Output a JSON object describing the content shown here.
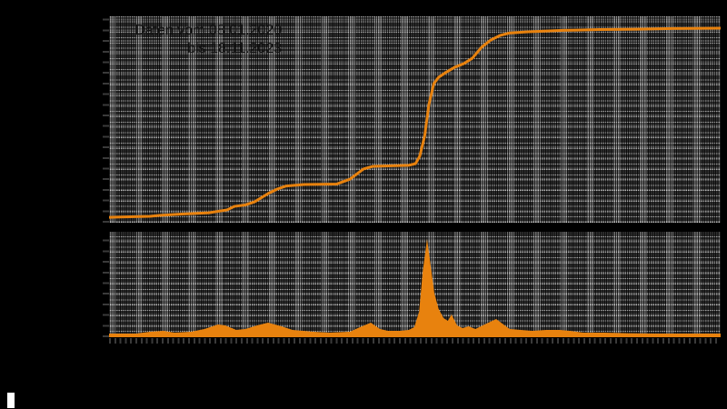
{
  "title": {
    "line1": "Daten vom 08.01.2020",
    "line2": "bis 18.11.2023"
  },
  "colors": {
    "page_background": "#000000",
    "plot_background": "#333333",
    "plot_band_light": "#6E6E6E",
    "grid_line": "#FFFFFF",
    "series_orange": "#E8820E",
    "title_text": "#121212",
    "cursor": "#FFFFFF"
  },
  "chart_data": [
    {
      "type": "line",
      "name": "cumulative-total",
      "title": "Daten vom 08.01.2020 bis 18.11.2023",
      "x_range": [
        "08.01.2020",
        "18.11.2023"
      ],
      "ylim": [
        0,
        100
      ],
      "y_unit": "percent-of-panel-height (no visible axis labels)",
      "grid": true,
      "legend": "none",
      "series": [
        {
          "name": "cumulative",
          "color": "#E8820E",
          "points": [
            [
              0.0,
              2.6
            ],
            [
              0.067,
              3.1
            ],
            [
              0.082,
              3.5
            ],
            [
              0.119,
              4.2
            ],
            [
              0.163,
              4.8
            ],
            [
              0.193,
              6.2
            ],
            [
              0.205,
              7.9
            ],
            [
              0.223,
              8.6
            ],
            [
              0.238,
              10.1
            ],
            [
              0.26,
              14.1
            ],
            [
              0.275,
              16.3
            ],
            [
              0.29,
              17.8
            ],
            [
              0.319,
              18.5
            ],
            [
              0.372,
              18.7
            ],
            [
              0.394,
              21.1
            ],
            [
              0.416,
              26.0
            ],
            [
              0.431,
              27.3
            ],
            [
              0.49,
              27.8
            ],
            [
              0.501,
              28.6
            ],
            [
              0.508,
              32.2
            ],
            [
              0.516,
              41.9
            ],
            [
              0.523,
              57.3
            ],
            [
              0.531,
              67.4
            ],
            [
              0.539,
              70.5
            ],
            [
              0.55,
              72.7
            ],
            [
              0.565,
              75.3
            ],
            [
              0.58,
              77.1
            ],
            [
              0.594,
              79.7
            ],
            [
              0.609,
              85.0
            ],
            [
              0.624,
              88.5
            ],
            [
              0.639,
              90.7
            ],
            [
              0.654,
              91.9
            ],
            [
              0.684,
              92.5
            ],
            [
              0.743,
              93.2
            ],
            [
              0.802,
              93.6
            ],
            [
              0.862,
              93.8
            ],
            [
              0.921,
              94.1
            ],
            [
              1.0,
              94.3
            ]
          ]
        }
      ]
    },
    {
      "type": "area",
      "name": "daily-values",
      "x_range": [
        "08.01.2020",
        "18.11.2023"
      ],
      "ylim": [
        0,
        100
      ],
      "y_unit": "percent-of-panel-height (no visible axis labels)",
      "grid": true,
      "legend": "none",
      "series": [
        {
          "name": "daily",
          "color": "#E8820E",
          "points": [
            [
              0.0,
              3.4
            ],
            [
              0.045,
              3.4
            ],
            [
              0.067,
              5.2
            ],
            [
              0.089,
              6.0
            ],
            [
              0.107,
              4.3
            ],
            [
              0.134,
              5.2
            ],
            [
              0.156,
              7.8
            ],
            [
              0.178,
              12.1
            ],
            [
              0.19,
              11.2
            ],
            [
              0.208,
              6.9
            ],
            [
              0.223,
              7.8
            ],
            [
              0.242,
              11.2
            ],
            [
              0.26,
              13.8
            ],
            [
              0.282,
              10.3
            ],
            [
              0.3,
              6.9
            ],
            [
              0.317,
              6.0
            ],
            [
              0.334,
              5.2
            ],
            [
              0.36,
              4.3
            ],
            [
              0.394,
              5.2
            ],
            [
              0.41,
              9.5
            ],
            [
              0.428,
              13.8
            ],
            [
              0.443,
              7.8
            ],
            [
              0.456,
              6.0
            ],
            [
              0.476,
              6.0
            ],
            [
              0.49,
              6.9
            ],
            [
              0.499,
              9.5
            ],
            [
              0.507,
              24.1
            ],
            [
              0.513,
              62.9
            ],
            [
              0.52,
              93.1
            ],
            [
              0.526,
              67.2
            ],
            [
              0.532,
              41.4
            ],
            [
              0.539,
              26.7
            ],
            [
              0.547,
              18.1
            ],
            [
              0.554,
              15.5
            ],
            [
              0.56,
              21.6
            ],
            [
              0.569,
              11.2
            ],
            [
              0.578,
              8.6
            ],
            [
              0.588,
              10.3
            ],
            [
              0.599,
              7.8
            ],
            [
              0.611,
              11.2
            ],
            [
              0.623,
              14.6
            ],
            [
              0.633,
              17.2
            ],
            [
              0.643,
              12.9
            ],
            [
              0.655,
              7.8
            ],
            [
              0.673,
              6.9
            ],
            [
              0.692,
              6.0
            ],
            [
              0.715,
              6.9
            ],
            [
              0.737,
              6.9
            ],
            [
              0.753,
              6.0
            ],
            [
              0.776,
              4.3
            ],
            [
              0.81,
              4.3
            ],
            [
              0.847,
              3.8
            ],
            [
              0.892,
              3.4
            ],
            [
              0.951,
              3.4
            ],
            [
              1.0,
              3.4
            ]
          ]
        }
      ]
    }
  ]
}
